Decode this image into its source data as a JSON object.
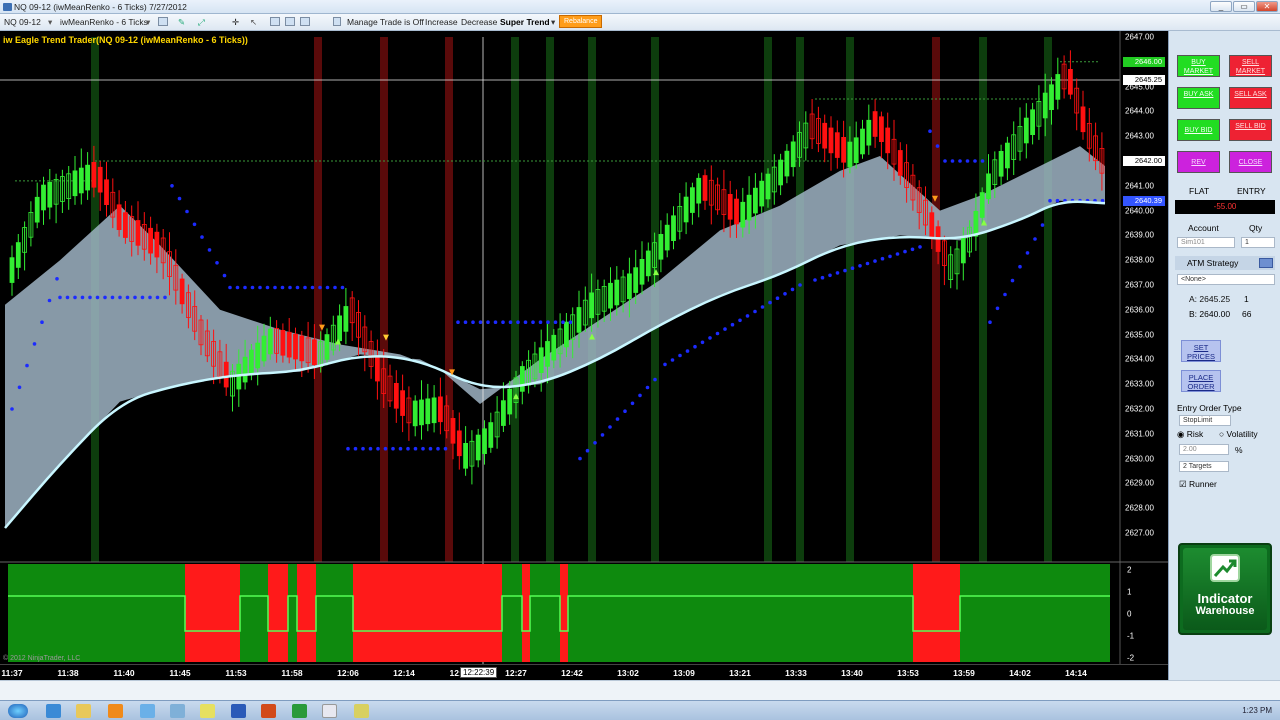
{
  "window": {
    "title": "NQ 09-12 (iwMeanRenko - 6 Ticks)  7/27/2012",
    "buttons": [
      "_",
      "▭",
      "✕"
    ]
  },
  "toolbar": {
    "instrument": "NQ 09-12",
    "period": "iwMeanRenko - 6 Ticks",
    "manage_trade": "Manage Trade is Off",
    "increase": "Increase",
    "decrease": "Decrease",
    "super_trend": "Super Trend",
    "orange_btn": "Rebalance"
  },
  "chart": {
    "title": "iw Eagle Trend Trader(NQ 09-12 (iwMeanRenko - 6 Ticks))",
    "copyright": "© 2012 NinjaTrader, LLC",
    "price_labels": [
      "2647.00",
      "2646.00",
      "2645.00",
      "2644.00",
      "2643.00",
      "2642.00",
      "2641.00",
      "2640.00",
      "2639.00",
      "2638.00",
      "2637.00",
      "2636.00",
      "2635.00",
      "2634.00",
      "2633.00",
      "2632.00",
      "2631.00",
      "2630.00",
      "2629.00",
      "2628.00",
      "2627.00"
    ],
    "price_tags": [
      {
        "text": "2646.00",
        "color": "#22cc22",
        "price": 2646.0
      },
      {
        "text": "2645.25",
        "color": "#ffffff",
        "price": 2645.25
      },
      {
        "text": "2642.00",
        "color": "#ffffff",
        "price": 2642.0
      },
      {
        "text": "2640.39",
        "color": "#3355ff",
        "price": 2640.39
      }
    ],
    "lower_panel_labels": [
      "2",
      "1",
      "0",
      "-1",
      "-2"
    ],
    "time_labels": [
      "11:37",
      "11:38",
      "11:40",
      "11:45",
      "11:53",
      "11:58",
      "12:06",
      "12:14",
      "12:2",
      "12:27",
      "12:42",
      "13:02",
      "13:09",
      "13:21",
      "13:33",
      "13:40",
      "13:53",
      "13:59",
      "14:02",
      "14:14"
    ],
    "time_cursor": "12:22:39"
  },
  "side_panel": {
    "buy_market": "BUY MARKET",
    "sell_market": "SELL MARKET",
    "buy_ask": "BUY ASK",
    "sell_ask": "SELL ASK",
    "buy_bid": "BUY BID",
    "sell_bid": "SELL BID",
    "rev": "REV",
    "close": "CLOSE",
    "flat": "FLAT",
    "entry": "ENTRY",
    "pnl": "-55.00",
    "account_label": "Account",
    "qty_label": "Qty",
    "account_value": "Sim101",
    "qty_value": "1",
    "atm_label": "ATM Strategy",
    "atm_value": "<None>",
    "ask_line": "A: 2645.25",
    "ask_size": "1",
    "bid_line": "B: 2640.00",
    "bid_size": "66",
    "set_prices": "SET PRICES",
    "place_order": "PLACE ORDER",
    "entry_type_label": "Entry Order Type",
    "entry_type_value": "StopLimit",
    "risk": "Risk",
    "volatility": "Volatility",
    "pct_value": "2.00",
    "pct": "%",
    "targets": "2 Targets",
    "runner": "Runner",
    "logo_line1": "Indicator",
    "logo_line2": "Warehouse"
  },
  "taskbar": {
    "clock": "1:23 PM"
  },
  "colors": {
    "up_bar": "#33ee33",
    "down_bar": "#ff1111",
    "band": "#9fb4c4",
    "trend_line": "#c8f6ff",
    "dots": "#1c2bff",
    "lower_green": "#0e8a0e",
    "lower_red": "#ff1a1a"
  }
}
